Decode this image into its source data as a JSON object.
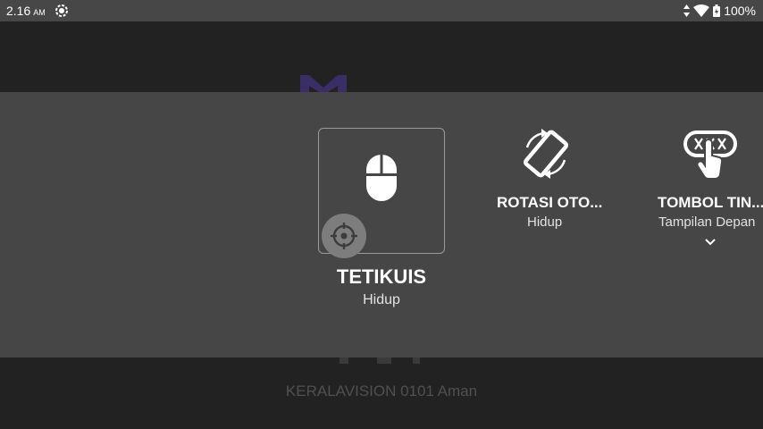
{
  "status_bar": {
    "time": "2.16",
    "ampm": "AM",
    "battery": "100%"
  },
  "background": {
    "network_label": "KERALAVISION 0101 Aman"
  },
  "tiles": [
    {
      "id": "mouse",
      "title": "TETIKUIS",
      "status": "Hidup",
      "icon": "mouse-icon"
    },
    {
      "id": "rotate",
      "title": "ROTASI OTO...",
      "status": "Hidup",
      "icon": "screen-rotation-icon"
    },
    {
      "id": "touch",
      "title": "TOMBOL TIN...",
      "status": "Tampilan Depan",
      "icon": "touch-buttons-icon"
    }
  ],
  "colors": {
    "panel": "#464646",
    "background": "#222222",
    "status_bar": "#474747"
  }
}
